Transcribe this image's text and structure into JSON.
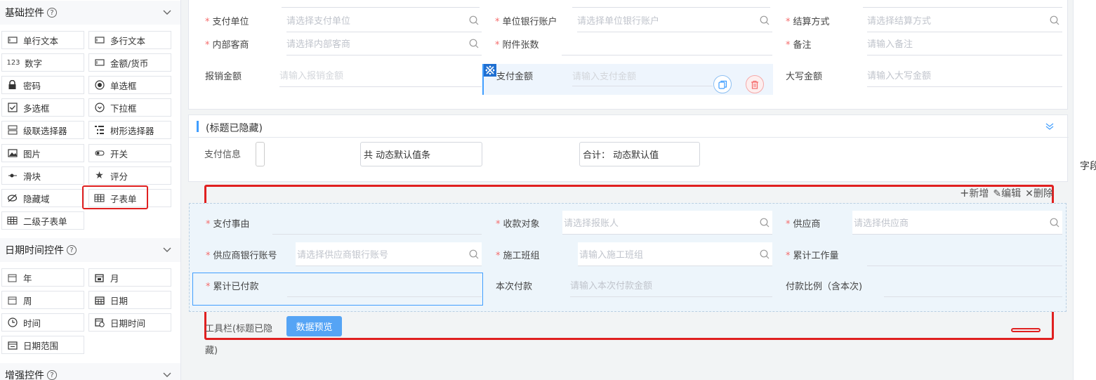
{
  "sidebar": {
    "basic": {
      "title": "基础控件",
      "items": [
        {
          "label": "单行文本",
          "icon": "single-line-text-icon"
        },
        {
          "label": "多行文本",
          "icon": "multi-line-text-icon"
        },
        {
          "label": "数字",
          "icon": "number-icon",
          "glyph": "123"
        },
        {
          "label": "金额/货币",
          "icon": "currency-icon"
        },
        {
          "label": "密码",
          "icon": "lock-icon"
        },
        {
          "label": "单选框",
          "icon": "radio-icon"
        },
        {
          "label": "多选框",
          "icon": "checkbox-icon"
        },
        {
          "label": "下拉框",
          "icon": "dropdown-icon"
        },
        {
          "label": "级联选择器",
          "icon": "cascader-icon"
        },
        {
          "label": "树形选择器",
          "icon": "tree-select-icon"
        },
        {
          "label": "图片",
          "icon": "image-icon"
        },
        {
          "label": "开关",
          "icon": "switch-icon"
        },
        {
          "label": "滑块",
          "icon": "slider-icon"
        },
        {
          "label": "评分",
          "icon": "star-icon"
        },
        {
          "label": "隐藏域",
          "icon": "eye-off-icon"
        },
        {
          "label": "子表单",
          "icon": "table-icon"
        },
        {
          "label": "二级子表单",
          "icon": "table-icon"
        }
      ]
    },
    "datetime": {
      "title": "日期时间控件",
      "items": [
        {
          "label": "年",
          "icon": "calendar-year-icon"
        },
        {
          "label": "月",
          "icon": "calendar-month-icon"
        },
        {
          "label": "周",
          "icon": "calendar-week-icon"
        },
        {
          "label": "日期",
          "icon": "calendar-date-icon"
        },
        {
          "label": "时间",
          "icon": "clock-icon"
        },
        {
          "label": "日期时间",
          "icon": "calendar-time-icon"
        },
        {
          "label": "日期范围",
          "icon": "date-range-icon"
        }
      ]
    },
    "enhanced": {
      "title": "增强控件"
    }
  },
  "form": {
    "row1": [
      {
        "label": "支付单位",
        "required": true,
        "placeholder": "请选择支付单位",
        "search": true
      },
      {
        "label": "单位银行账户",
        "required": true,
        "placeholder": "请选择单位银行账户",
        "search": true
      },
      {
        "label": "结算方式",
        "required": true,
        "placeholder": "请选择结算方式",
        "search": true
      }
    ],
    "row2": [
      {
        "label": "内部客商",
        "required": true,
        "placeholder": "请选择内部客商",
        "search": true
      },
      {
        "label": "附件张数",
        "required": true,
        "placeholder": "",
        "search": false
      },
      {
        "label": "备注",
        "required": true,
        "placeholder": "请输入备注",
        "search": false
      }
    ],
    "row3": [
      {
        "label": "报销金额",
        "required": false,
        "placeholder": "请输入报销金额"
      },
      {
        "label": "支付金额",
        "required": false,
        "placeholder": "请输入支付金额"
      },
      {
        "label": "大写金额",
        "required": false,
        "placeholder": "请输入大写金额"
      }
    ]
  },
  "section2": {
    "title": "(标题已隐藏)",
    "pay_info_label": "支付信息",
    "count_text": "共 动态默认值条",
    "total_text": "合计： 动态默认值"
  },
  "subform": {
    "actions": {
      "add": "新增",
      "edit": "编辑",
      "delete": "删除"
    },
    "row1": [
      {
        "label": "支付事由",
        "required": true,
        "placeholder": ""
      },
      {
        "label": "收款对象",
        "required": true,
        "placeholder": "请选择报账人"
      },
      {
        "label": "供应商",
        "required": true,
        "placeholder": "请选择供应商"
      }
    ],
    "row2": [
      {
        "label": "供应商银行账号",
        "required": true,
        "placeholder": "请选择供应商银行账号"
      },
      {
        "label": "施工班组",
        "required": true,
        "placeholder": "请输入施工班组"
      },
      {
        "label": "累计工作量",
        "required": true,
        "placeholder": ""
      }
    ],
    "row3": [
      {
        "label": "累计已付款",
        "required": true,
        "placeholder": ""
      },
      {
        "label": "本次付款",
        "required": false,
        "placeholder": "请输入本次付款金额"
      },
      {
        "label": "付款比例（含本次)",
        "required": false,
        "placeholder": ""
      }
    ],
    "toolbar_label_line1": "工具栏(标题已隐",
    "toolbar_label_line2": "藏)",
    "preview_button": "数据预览"
  },
  "right_panel": {
    "label": "字段"
  },
  "colors": {
    "primary": "#409eff",
    "highlight": "#e02020",
    "danger": "#f56c6c"
  }
}
